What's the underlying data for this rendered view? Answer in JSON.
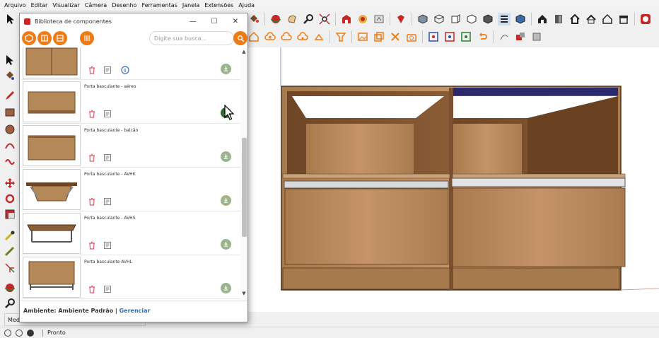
{
  "menubar": {
    "items": [
      "Arquivo",
      "Editar",
      "Visualizar",
      "Câmera",
      "Desenho",
      "Ferramentas",
      "Janela",
      "Extensões",
      "Ajuda"
    ]
  },
  "library": {
    "title": "Biblioteca de componentes",
    "minimize_label": "—",
    "maximize_label": "☐",
    "close_label": "✕",
    "search_placeholder": "Digite sua busca...",
    "categories": [
      "cube-category",
      "cabinet-category",
      "drawer-category",
      "tools-category"
    ],
    "items": [
      {
        "name": ""
      },
      {
        "name": "Porta basculante - aéreo"
      },
      {
        "name": "Porta basculante - balcão"
      },
      {
        "name": "Porta basculante - AVHK"
      },
      {
        "name": "Porta basculante - AVHS"
      },
      {
        "name": "Porta basculante AVHL"
      }
    ],
    "footer": {
      "environment_label": "Ambiente: Ambiente Padrão | ",
      "manage_link": "Gerenciar"
    }
  },
  "measurements": {
    "label": "Med"
  },
  "status": {
    "text": "Pronto"
  },
  "colors": {
    "accent": "#f07b14",
    "download_inactive": "#9cb38c",
    "download_active": "#2f6b2c",
    "wood": "#b78a5c",
    "link": "#2a6fba"
  }
}
